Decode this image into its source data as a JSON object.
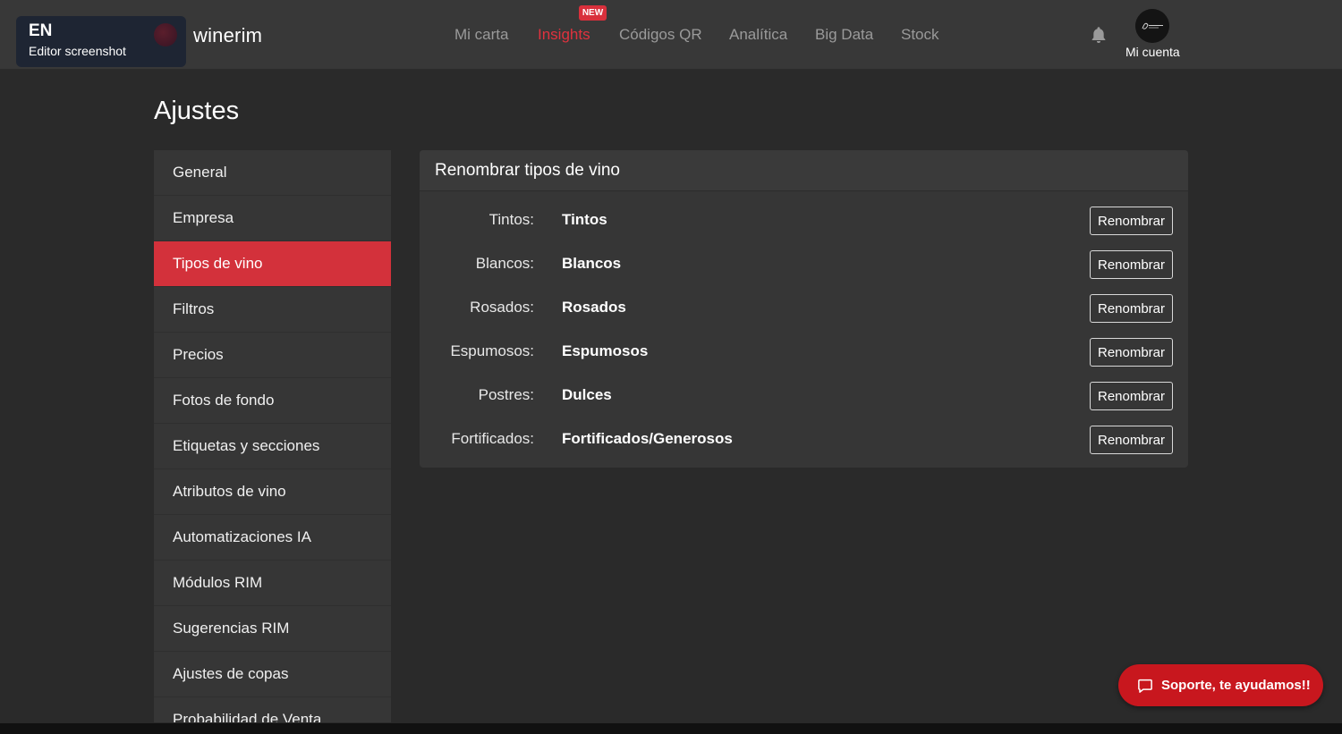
{
  "header": {
    "language_code": "EN",
    "language_subtitle": "Editor screenshot",
    "brand": "winerim",
    "nav": [
      {
        "label": "Mi carta",
        "active": false
      },
      {
        "label": "Insights",
        "active": true
      },
      {
        "label": "Códigos QR",
        "active": false
      },
      {
        "label": "Analítica",
        "active": false
      },
      {
        "label": "Big Data",
        "active": false
      },
      {
        "label": "Stock",
        "active": false
      }
    ],
    "new_badge": "NEW",
    "account_label": "Mi cuenta",
    "accent_color": "#e0323e"
  },
  "page": {
    "title": "Ajustes"
  },
  "sidebar": {
    "items": [
      {
        "label": "General"
      },
      {
        "label": "Empresa"
      },
      {
        "label": "Tipos de vino",
        "active": true
      },
      {
        "label": "Filtros"
      },
      {
        "label": "Precios"
      },
      {
        "label": "Fotos de fondo"
      },
      {
        "label": "Etiquetas y secciones"
      },
      {
        "label": "Atributos de vino"
      },
      {
        "label": "Automatizaciones IA"
      },
      {
        "label": "Módulos RIM"
      },
      {
        "label": "Sugerencias RIM"
      },
      {
        "label": "Ajustes de copas"
      },
      {
        "label": "Probabilidad de Venta"
      }
    ]
  },
  "panel": {
    "title": "Renombrar tipos de vino",
    "rows": [
      {
        "label": "Tintos:",
        "value": "Tintos",
        "button": "Renombrar"
      },
      {
        "label": "Blancos:",
        "value": "Blancos",
        "button": "Renombrar"
      },
      {
        "label": "Rosados:",
        "value": "Rosados",
        "button": "Renombrar"
      },
      {
        "label": "Espumosos:",
        "value": "Espumosos",
        "button": "Renombrar"
      },
      {
        "label": "Postres:",
        "value": "Dulces",
        "button": "Renombrar"
      },
      {
        "label": "Fortificados:",
        "value": "Fortificados/Generosos",
        "button": "Renombrar"
      }
    ]
  },
  "support": {
    "label": "Soporte, te ayudamos!!"
  }
}
